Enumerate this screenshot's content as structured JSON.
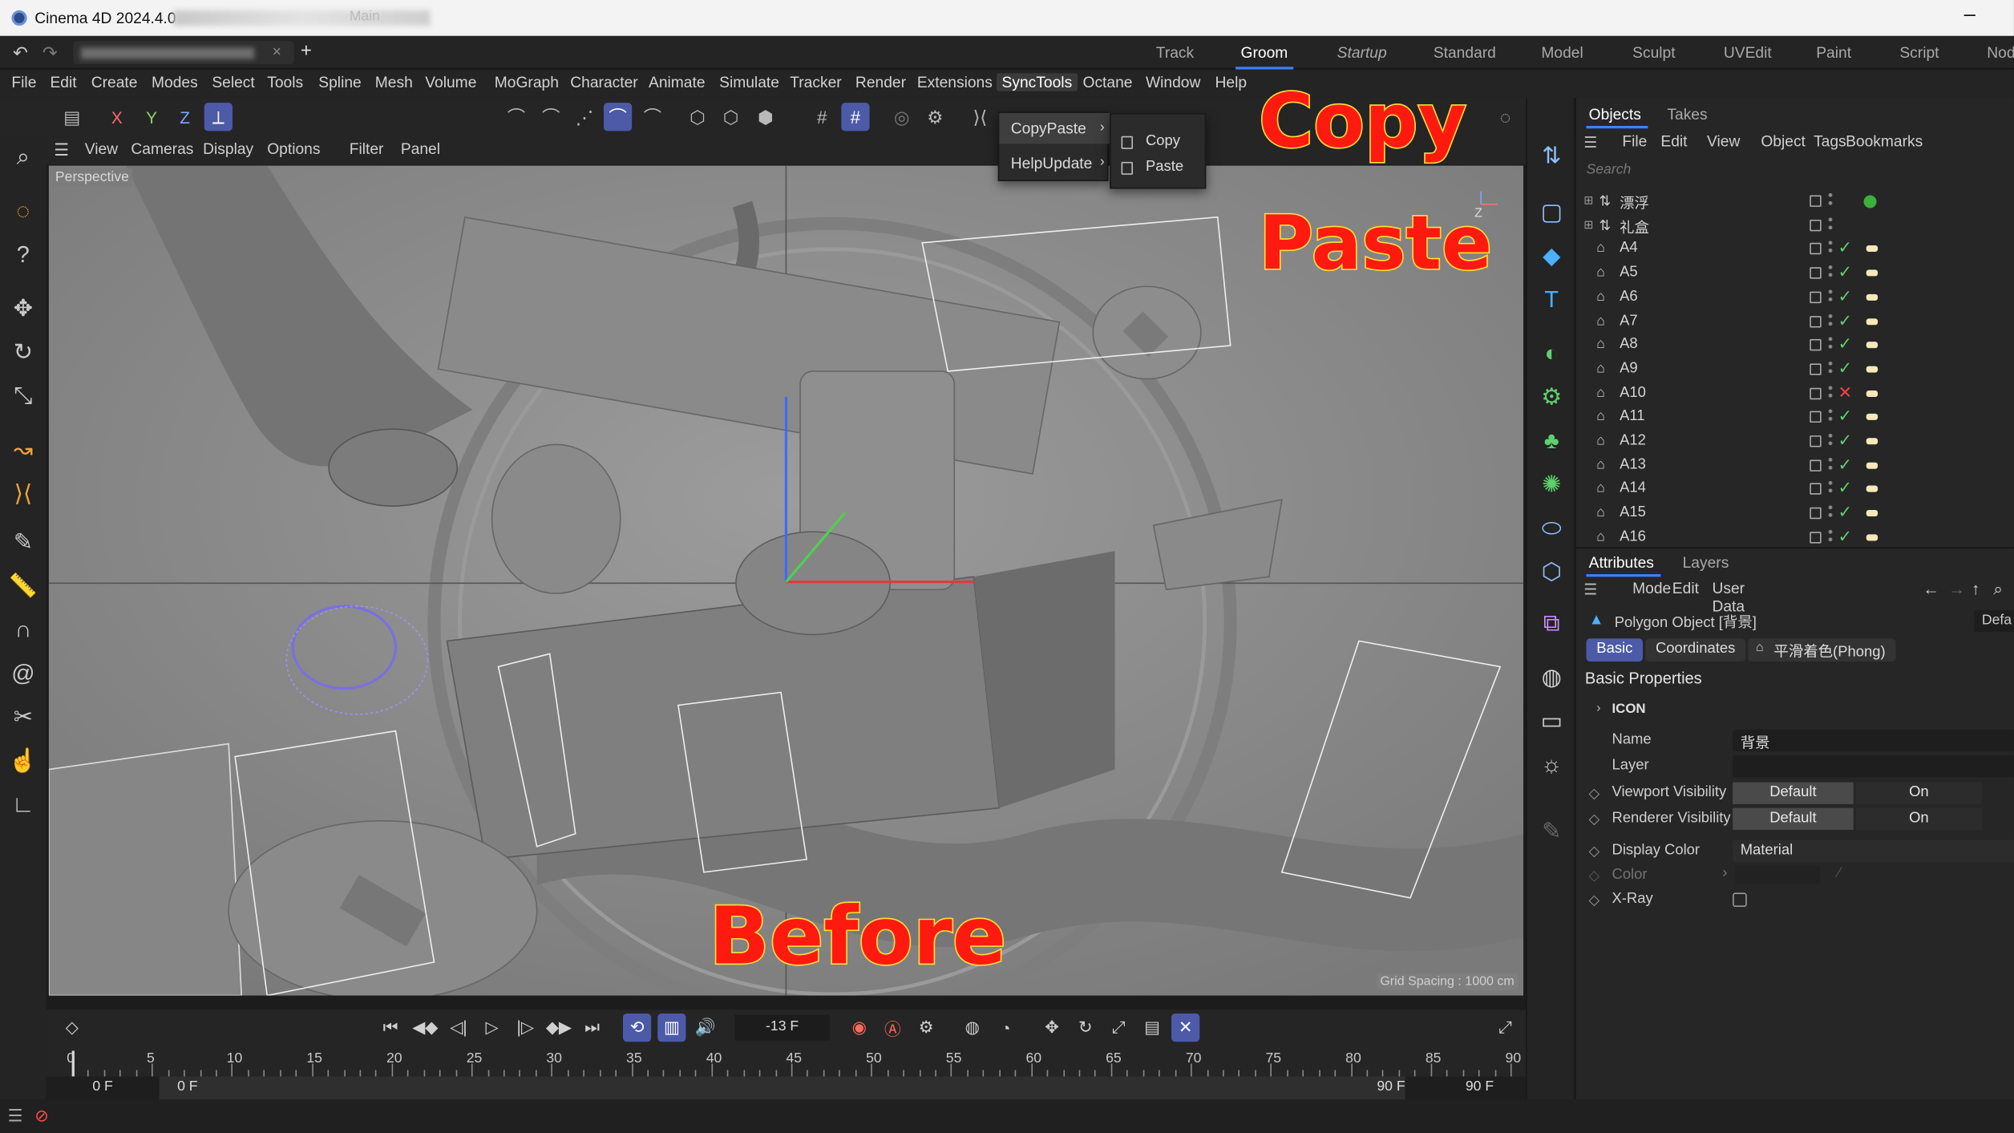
{
  "window": {
    "title": "Cinema 4D 2024.4.0 -",
    "title_suffix": "Main"
  },
  "tabs": {
    "doc_tab_close": "×",
    "new_tab": "+",
    "layouts": [
      {
        "label": "Track",
        "active": false,
        "italic": false
      },
      {
        "label": "Groom",
        "active": true,
        "italic": false
      },
      {
        "label": "Startup",
        "active": false,
        "italic": true
      },
      {
        "label": "Standard",
        "active": false,
        "italic": false
      },
      {
        "label": "Model",
        "active": false,
        "italic": false
      },
      {
        "label": "Sculpt",
        "active": false,
        "italic": false
      },
      {
        "label": "UVEdit",
        "active": false,
        "italic": false
      },
      {
        "label": "Paint",
        "active": false,
        "italic": false
      },
      {
        "label": "Script",
        "active": false,
        "italic": false
      },
      {
        "label": "Nod",
        "active": false,
        "italic": false
      }
    ]
  },
  "menubar": [
    "File",
    "Edit",
    "Create",
    "Modes",
    "Select",
    "Tools",
    "Spline",
    "Mesh",
    "Volume",
    "MoGraph",
    "Character",
    "Animate",
    "Simulate",
    "Tracker",
    "Render",
    "Extensions",
    "SyncTools",
    "Octane",
    "Window",
    "Help"
  ],
  "menubar_active": "SyncTools",
  "toolbar": {
    "axis_x": "X",
    "axis_y": "Y",
    "axis_z": "Z"
  },
  "dropdown": {
    "items": [
      {
        "label": "CopyPaste",
        "selected": true
      },
      {
        "label": "HelpUpdate",
        "selected": false
      }
    ],
    "submenu": [
      {
        "label": "Copy"
      },
      {
        "label": "Paste"
      }
    ]
  },
  "viewport": {
    "menu": [
      "View",
      "Cameras",
      "Display",
      "Options",
      "Filter",
      "Panel"
    ],
    "camera_label": "Perspective",
    "grid_spacing": "Grid Spacing : 1000 cm"
  },
  "overlay": {
    "copy": "Copy",
    "paste": "Paste",
    "before": "Before",
    "color": "#ff1a10",
    "outline": "#ffdf3a"
  },
  "objects_panel": {
    "tabs": [
      {
        "label": "Objects",
        "active": true
      },
      {
        "label": "Takes",
        "active": false
      }
    ],
    "menu": [
      "File",
      "Edit",
      "View",
      "Object",
      "Tags",
      "Bookmarks"
    ],
    "search_placeholder": "Search",
    "rows": [
      {
        "name": "漂浮",
        "group": true,
        "status": "dot"
      },
      {
        "name": "礼盒",
        "group": true,
        "status": "none"
      },
      {
        "name": "A4",
        "group": false,
        "status": "check"
      },
      {
        "name": "A5",
        "group": false,
        "status": "check"
      },
      {
        "name": "A6",
        "group": false,
        "status": "check"
      },
      {
        "name": "A7",
        "group": false,
        "status": "check"
      },
      {
        "name": "A8",
        "group": false,
        "status": "check"
      },
      {
        "name": "A9",
        "group": false,
        "status": "check"
      },
      {
        "name": "A10",
        "group": false,
        "status": "cross"
      },
      {
        "name": "A11",
        "group": false,
        "status": "check"
      },
      {
        "name": "A12",
        "group": false,
        "status": "check"
      },
      {
        "name": "A13",
        "group": false,
        "status": "check"
      },
      {
        "name": "A14",
        "group": false,
        "status": "check"
      },
      {
        "name": "A15",
        "group": false,
        "status": "check"
      },
      {
        "name": "A16",
        "group": false,
        "status": "check"
      }
    ]
  },
  "attributes_panel": {
    "tabs": [
      {
        "label": "Attributes",
        "active": true
      },
      {
        "label": "Layers",
        "active": false
      }
    ],
    "menu": [
      "Mode",
      "Edit",
      "User Data"
    ],
    "object_title": "Polygon Object [背景]",
    "preset": "Defa",
    "subtabs": [
      {
        "label": "Basic",
        "active": true
      },
      {
        "label": "Coordinates",
        "active": false
      },
      {
        "label": "平滑着色(Phong)",
        "active": false
      }
    ],
    "section": "Basic Properties",
    "icon_group": "ICON",
    "fields": {
      "name_label": "Name",
      "name_value": "背景",
      "layer_label": "Layer",
      "viewport_visibility_label": "Viewport Visibility",
      "viewport_visibility_a": "Default",
      "viewport_visibility_b": "On",
      "renderer_visibility_label": "Renderer Visibility",
      "renderer_visibility_a": "Default",
      "renderer_visibility_b": "On",
      "display_color_label": "Display Color",
      "display_color_value": "Material",
      "color_label": "Color",
      "xray_label": "X-Ray"
    }
  },
  "timeline": {
    "current_frame": "-13 F",
    "ticks": [
      0,
      5,
      10,
      15,
      20,
      25,
      30,
      35,
      40,
      45,
      50,
      55,
      60,
      65,
      70,
      75,
      80,
      85,
      90
    ],
    "start_a": "0 F",
    "start_b": "0 F",
    "end_a": "90 F",
    "end_b": "90 F"
  },
  "colors": {
    "accent_blue": "#4c5aa8",
    "active_underline": "#3b82ff",
    "check_green": "#5fd06a",
    "cross_red": "#ff4040"
  }
}
